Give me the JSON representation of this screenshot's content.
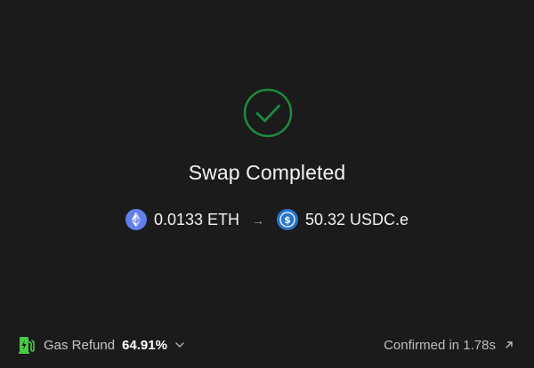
{
  "status": {
    "title": "Swap Completed",
    "icon": "check-circle-icon",
    "accent_color": "#1e8a3f"
  },
  "swap": {
    "from": {
      "amount_label": "0.0133 ETH",
      "icon": "eth-icon",
      "color": "#627eea"
    },
    "arrow": "→",
    "to": {
      "amount_label": "50.32 USDC.e",
      "icon": "usdc-icon",
      "color": "#2775ca"
    }
  },
  "footer": {
    "gas_refund_label": "Gas Refund",
    "gas_refund_value": "64.91%",
    "gas_icon": "fuel-pump-icon",
    "gas_icon_color": "#47c94a",
    "confirmed_text": "Confirmed in 1.78s",
    "confirmed_icon": "external-link-icon"
  }
}
